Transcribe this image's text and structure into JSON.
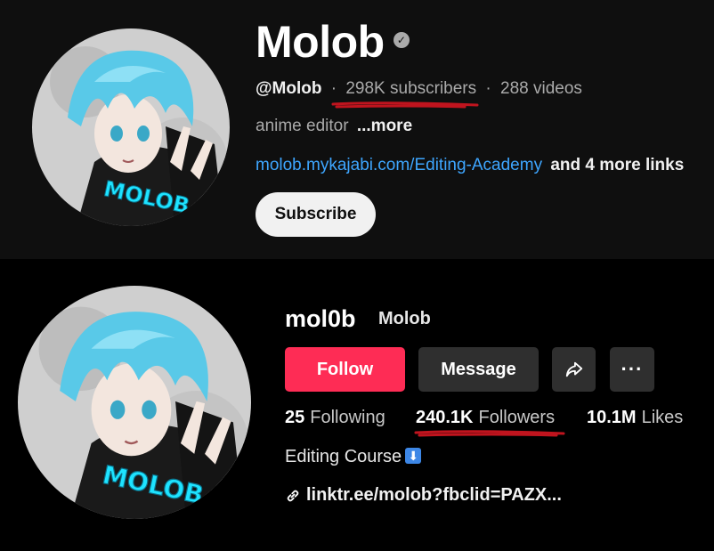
{
  "youtube": {
    "channel_name": "Molob",
    "verified_icon": "verified-check-icon",
    "handle": "@Molob",
    "separator": "·",
    "subscribers": "298K subscribers",
    "videos": "288 videos",
    "description": "anime editor",
    "more": "...more",
    "link": "molob.mykajabi.com/Editing-Academy",
    "more_links": "and 4 more links",
    "subscribe_label": "Subscribe",
    "avatar_text": "MOLOB"
  },
  "tiktok": {
    "username": "mol0b",
    "nickname": "Molob",
    "follow_label": "Follow",
    "message_label": "Message",
    "share_icon": "share-arrow-icon",
    "more_icon": "more-dots-icon",
    "more_glyph": "···",
    "following_count": "25",
    "following_label": "Following",
    "followers_count": "240.1K",
    "followers_label": "Followers",
    "likes_count": "10.1M",
    "likes_label": "Likes",
    "bio": "Editing Course",
    "bio_arrow": "⬇",
    "link": "linktr.ee/molob?fbclid=PAZX...",
    "link_icon": "link-icon",
    "avatar_text": "MOLOB"
  },
  "colors": {
    "follow": "#fe2c55",
    "link_blue": "#3ea6ff",
    "underline_red": "#c0141e"
  }
}
